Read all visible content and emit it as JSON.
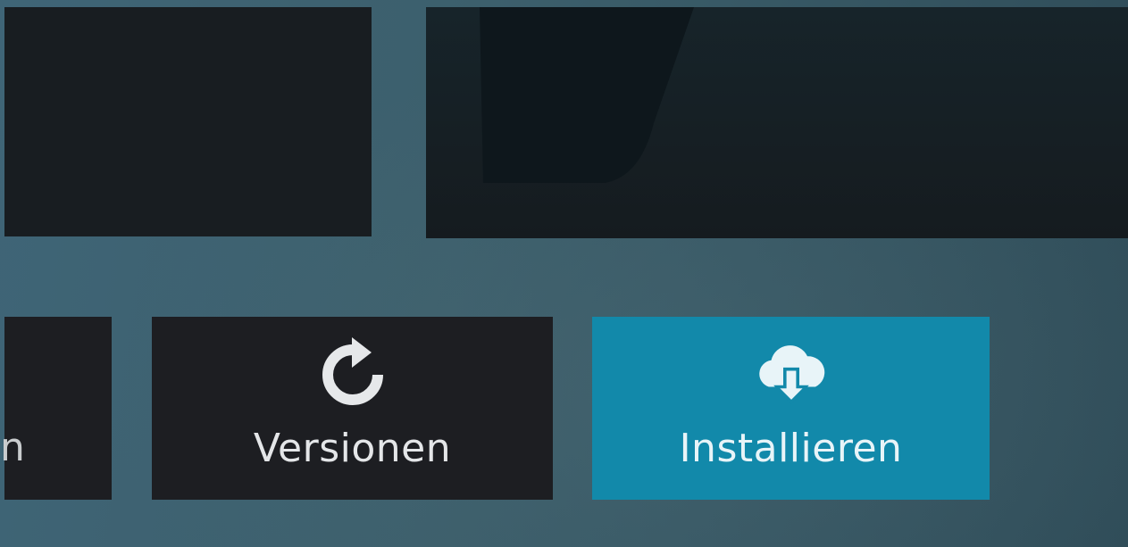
{
  "buttons": {
    "partial": {
      "label_fragment": "n"
    },
    "versions": {
      "label": "Versionen",
      "icon": "refresh-icon"
    },
    "install": {
      "label": "Installieren",
      "icon": "cloud-download-icon",
      "state": "focused"
    }
  },
  "colors": {
    "background": "#3c5f6c",
    "button_default": "#1d1e22",
    "button_focused": "#1289aa",
    "text": "#e4e6e8"
  }
}
